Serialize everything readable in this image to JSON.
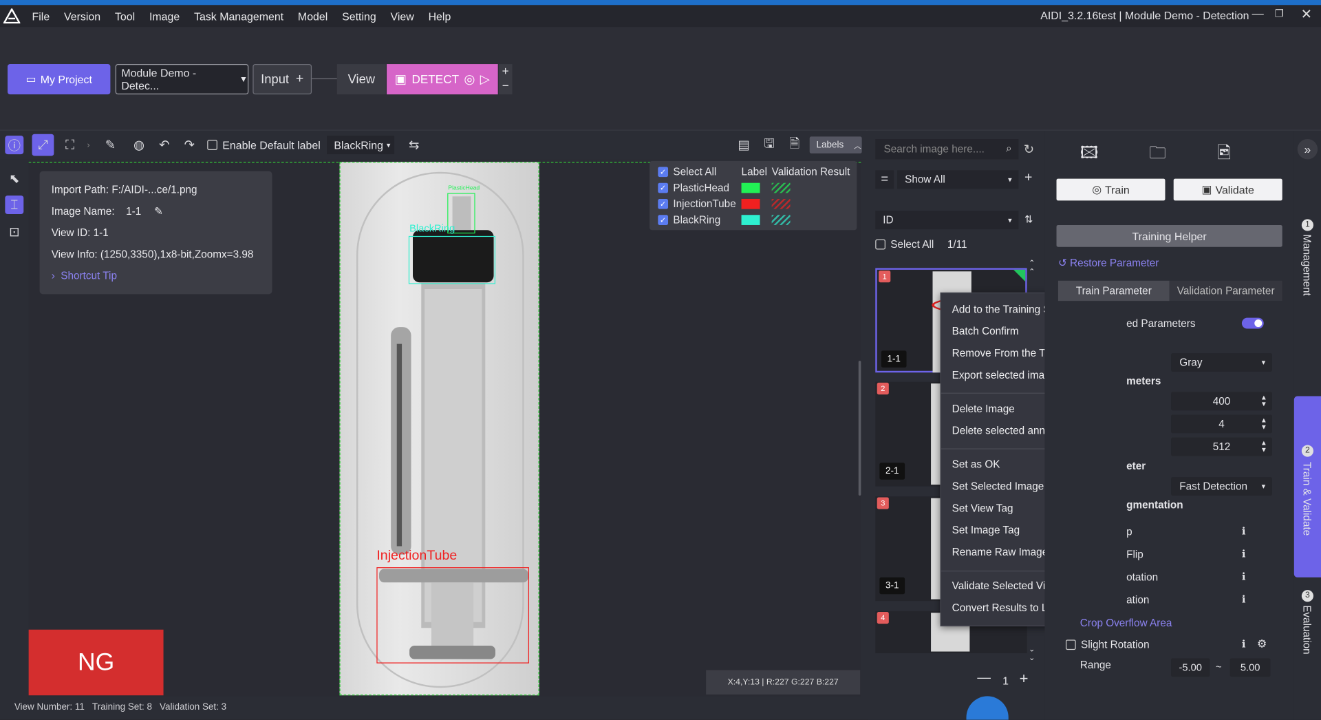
{
  "app": {
    "window_title": "AIDI_3.2.16test | Module Demo - Detection",
    "menu": [
      "File",
      "Version",
      "Tool",
      "Image",
      "Task Management",
      "Model",
      "Setting",
      "View",
      "Help"
    ]
  },
  "project": {
    "my_project": "My Project",
    "module_select": "Module Demo - Detec...",
    "input": "Input",
    "view": "View",
    "detect": "DETECT"
  },
  "toolbar": {
    "enable_default_label": "Enable Default label",
    "label_select": "BlackRing",
    "labels_btn": "Labels"
  },
  "info": {
    "import_path": "Import Path: F:/AIDI-...ce/1.png",
    "image_name_label": "Image Name:",
    "image_name_value": "1-1",
    "view_id": "View ID: 1-1",
    "view_info": "View Info: (1250,3350),1x8-bit,Zoomx=3.98",
    "shortcut_tip": "Shortcut Tip"
  },
  "legend": {
    "select_all": "Select All",
    "col_label": "Label",
    "col_validation": "Validation Result",
    "rows": [
      {
        "name": "PlasticHead",
        "color": "#22f055"
      },
      {
        "name": "InjectionTube",
        "color": "#f02020"
      },
      {
        "name": "BlackRing",
        "color": "#2ef0d0"
      }
    ]
  },
  "annotations": {
    "plastic_head": "PlasticHead",
    "black_ring": "BlackRing",
    "injection_tube": "InjectionTube"
  },
  "result": "NG",
  "pixel_readout": "X:4,Y:13 | R:227 G:227 B:227",
  "status": {
    "view_number": "View Number:  11",
    "training_set": "Training Set:  8",
    "validation_set": "Validation Set:  3"
  },
  "image_list": {
    "search_placeholder": "Search image here....",
    "filter": "Show All",
    "sort": "ID",
    "select_all": "Select All",
    "count": "1/11",
    "items": [
      {
        "index": "1",
        "name": "1-1"
      },
      {
        "index": "2",
        "name": "2-1"
      },
      {
        "index": "3",
        "name": "3-1"
      },
      {
        "index": "4",
        "name": ""
      }
    ],
    "page": "1"
  },
  "context_menu": {
    "items": [
      "Add to the Training Set",
      "Batch Confirm",
      "Remove From the Training Set",
      "Export selected image or label",
      "Delete Image",
      "Delete selected annotation",
      "Set as OK",
      "Set Selected Image Label",
      "Set View Tag",
      "Set Image Tag",
      "Rename Raw Image",
      "Validate Selected View",
      "Convert Results to Label"
    ]
  },
  "right_panel": {
    "train": "Train",
    "validate": "Validate",
    "training_helper": "Training Helper",
    "restore": "Restore Parameter",
    "tab_train": "Train Parameter",
    "tab_validation": "Validation Parameter",
    "advanced": "ed Parameters",
    "gray": "Gray",
    "meters": "meters",
    "val1": "400",
    "val2": "4",
    "val3": "512",
    "eter": "eter",
    "fast_detection": "Fast Detection",
    "augmentation": "gmentation",
    "p": "p",
    "flip": "Flip",
    "otation": "otation",
    "ation": "ation",
    "crop_overflow": "Crop Overflow Area",
    "slight_rotation": "Slight Rotation",
    "range": "Range",
    "range_min": "-5.00",
    "range_sep": "~",
    "range_max": "5.00"
  },
  "side_tabs": [
    {
      "num": "1",
      "label": "Management"
    },
    {
      "num": "2",
      "label": "Train & Validate"
    },
    {
      "num": "3",
      "label": "Evaluation"
    }
  ]
}
